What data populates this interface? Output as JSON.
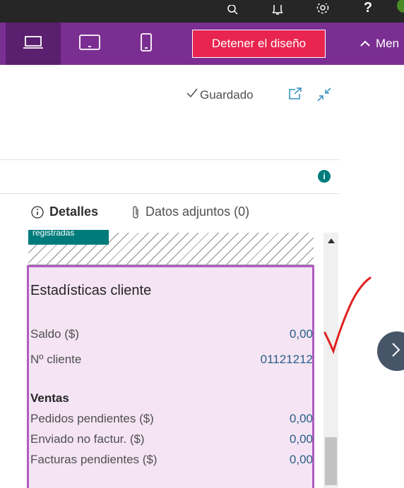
{
  "topbar": {
    "icons": [
      "search-icon",
      "bell-icon",
      "gear-icon",
      "help-icon",
      "avatar"
    ],
    "help_label": "?"
  },
  "design_bar": {
    "devices": [
      "laptop-icon",
      "tablet-icon",
      "phone-icon"
    ],
    "stop_label": "Detener el diseño",
    "menu_label": "Men"
  },
  "header": {
    "saved_label": "Guardado",
    "icons": [
      "open-new-window-icon",
      "collapse-icon"
    ]
  },
  "info_badge": "i",
  "tabs": [
    {
      "label": "Detalles",
      "icon": "info-icon",
      "active": true
    },
    {
      "label": "Datos adjuntos (0)",
      "icon": "paperclip-icon",
      "active": false
    }
  ],
  "registered_label": "registradas",
  "stats": {
    "title": "Estadísticas cliente",
    "balance": {
      "label": "Saldo ($)",
      "value": "0,00"
    },
    "customer_no": {
      "label": "Nº cliente",
      "value": "01121212"
    },
    "sales_heading": "Ventas",
    "pending_orders": {
      "label": "Pedidos pendientes ($)",
      "value": "0,00"
    },
    "shipped_not_invoiced": {
      "label": "Enviado no factur. ($)",
      "value": "0,00"
    },
    "pending_invoices": {
      "label": "Facturas pendientes ($)",
      "value": "0,00"
    }
  },
  "colors": {
    "design_bar": "#7b2e92",
    "stop_button": "#e8244f",
    "stats_border": "#b05cc0",
    "stats_bg": "#f4e4f4",
    "teal": "#007b7b",
    "annotation_red": "#e02020"
  }
}
